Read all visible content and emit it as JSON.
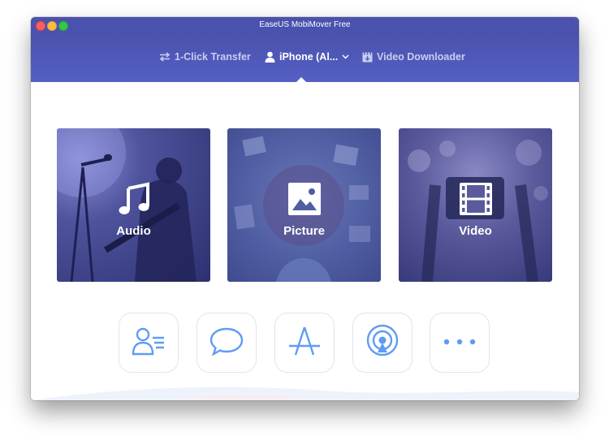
{
  "window": {
    "title": "EaseUS MobiMover Free"
  },
  "nav": {
    "items": [
      {
        "label": "1-Click Transfer",
        "icon": "transfer-arrows-icon",
        "active": false
      },
      {
        "label": "iPhone (Al...",
        "icon": "user-icon",
        "active": true,
        "has_dropdown": true
      },
      {
        "label": "Video Downloader",
        "icon": "video-download-icon",
        "active": false
      }
    ]
  },
  "categories": [
    {
      "label": "Audio",
      "icon": "music-note-icon"
    },
    {
      "label": "Picture",
      "icon": "image-icon"
    },
    {
      "label": "Video",
      "icon": "film-icon"
    }
  ],
  "quick_buttons": [
    {
      "icon": "contacts-icon"
    },
    {
      "icon": "message-bubble-icon"
    },
    {
      "icon": "app-store-icon"
    },
    {
      "icon": "podcast-icon"
    },
    {
      "icon": "more-dots-icon"
    }
  ],
  "colors": {
    "accent": "#4a52ad",
    "icon_blue": "#5f9cf2",
    "nav_inactive": "#c9cdf0"
  }
}
